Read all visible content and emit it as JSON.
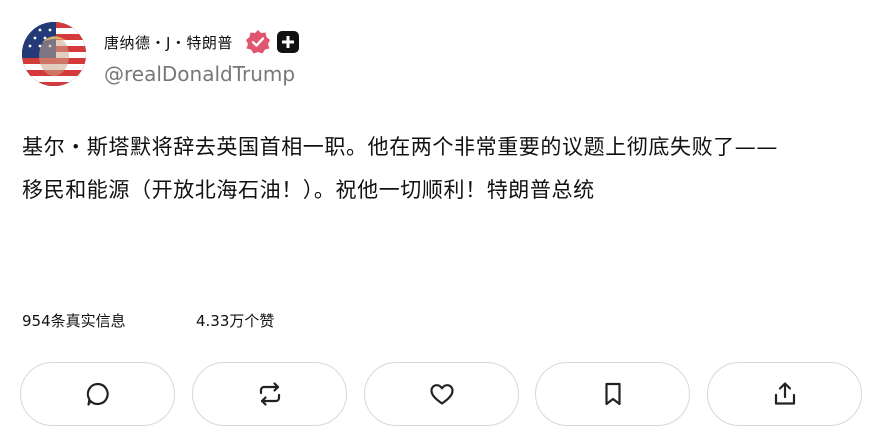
{
  "author": {
    "display_name": "唐纳德・J・特朗普",
    "handle": "@realDonaldTrump",
    "avatar_icon": "avatar-flag-portrait",
    "verified_icon": "verified-badge-icon",
    "verified_color": "#e0566e",
    "plus_icon": "plus-badge-icon"
  },
  "post": {
    "line1": "基尔・斯塔默将辞去英国首相一职。他在两个非常重要的议题上彻底失败了——",
    "line2": "移民和能源（开放北海石油！）。祝他一切顺利！特朗普总统"
  },
  "stats": {
    "retruths": "954条真实信息",
    "likes": "4.33万个赞"
  },
  "actions": [
    {
      "name": "reply-button",
      "icon": "comment-icon"
    },
    {
      "name": "retruth-button",
      "icon": "repost-icon"
    },
    {
      "name": "like-button",
      "icon": "heart-icon"
    },
    {
      "name": "bookmark-button",
      "icon": "bookmark-icon"
    },
    {
      "name": "share-button",
      "icon": "share-icon"
    }
  ]
}
